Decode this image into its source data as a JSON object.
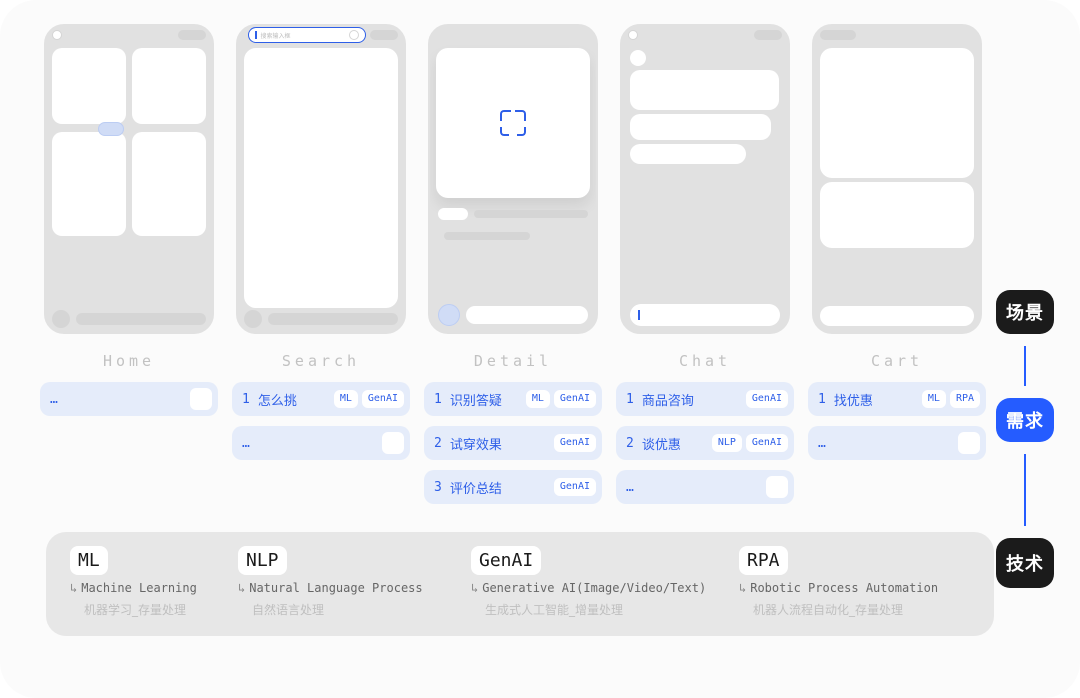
{
  "columns": [
    {
      "id": "home",
      "label": "Home"
    },
    {
      "id": "search",
      "label": "Search"
    },
    {
      "id": "detail",
      "label": "Detail"
    },
    {
      "id": "chat",
      "label": "Chat"
    },
    {
      "id": "cart",
      "label": "Cart"
    }
  ],
  "search_placeholder": "搜索输入框",
  "needs": {
    "home": [
      {
        "idx": "…",
        "text": "",
        "tags": [],
        "more": true
      }
    ],
    "search": [
      {
        "idx": "1",
        "text": "怎么挑",
        "tags": [
          "ML",
          "GenAI"
        ]
      },
      {
        "idx": "…",
        "text": "",
        "tags": [],
        "more": true
      }
    ],
    "detail": [
      {
        "idx": "1",
        "text": "识别答疑",
        "tags": [
          "ML",
          "GenAI"
        ]
      },
      {
        "idx": "2",
        "text": "试穿效果",
        "tags": [
          "GenAI"
        ]
      },
      {
        "idx": "3",
        "text": "评价总结",
        "tags": [
          "GenAI"
        ]
      }
    ],
    "chat": [
      {
        "idx": "1",
        "text": "商品咨询",
        "tags": [
          "GenAI"
        ]
      },
      {
        "idx": "2",
        "text": "谈优惠",
        "tags": [
          "NLP",
          "GenAI"
        ]
      },
      {
        "idx": "…",
        "text": "",
        "tags": [],
        "more": true
      }
    ],
    "cart": [
      {
        "idx": "1",
        "text": "找优惠",
        "tags": [
          "ML",
          "RPA"
        ]
      },
      {
        "idx": "…",
        "text": "",
        "tags": [],
        "more": true
      }
    ]
  },
  "tech": [
    {
      "abbr": "ML",
      "full": "Machine Learning",
      "cn": "机器学习_存量处理"
    },
    {
      "abbr": "NLP",
      "full": "Natural Language Process",
      "cn": "自然语言处理"
    },
    {
      "abbr": "GenAI",
      "full": "Generative AI(Image/Video/Text)",
      "cn": "生成式人工智能_增量处理"
    },
    {
      "abbr": "RPA",
      "full": "Robotic Process Automation",
      "cn": "机器人流程自动化_存量处理"
    }
  ],
  "stages": {
    "scene": "场景",
    "need": "需求",
    "tech": "技术"
  }
}
